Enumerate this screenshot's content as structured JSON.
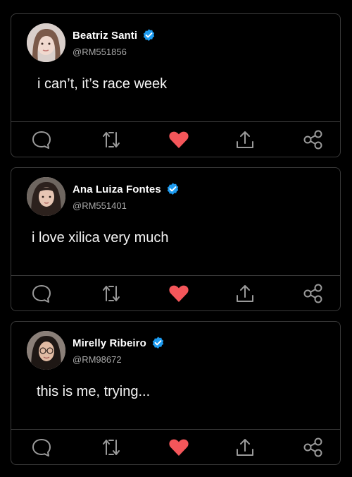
{
  "icons": {
    "verified": "verified-badge-icon",
    "reply": "reply-bubble-icon",
    "retweet": "retweet-icon",
    "like": "heart-icon",
    "share": "share-upload-icon",
    "more": "share-nodes-icon"
  },
  "colors": {
    "background": "#000000",
    "card_border": "#3a3a3a",
    "verified_blue": "#1d9bf0",
    "like_red": "#f4565a",
    "icon_gray": "#9a9a9a",
    "handle_gray": "#a8a8a8"
  },
  "tweets": [
    {
      "name": "Beatriz Santi",
      "handle": "@RM551856",
      "text": "i can’t, it’s race week"
    },
    {
      "name": "Ana Luiza Fontes",
      "handle": "@RM551401",
      "text": "i love xilica very much"
    },
    {
      "name": "Mirelly Ribeiro",
      "handle": "@RM98672",
      "text": "this is me, trying..."
    }
  ]
}
